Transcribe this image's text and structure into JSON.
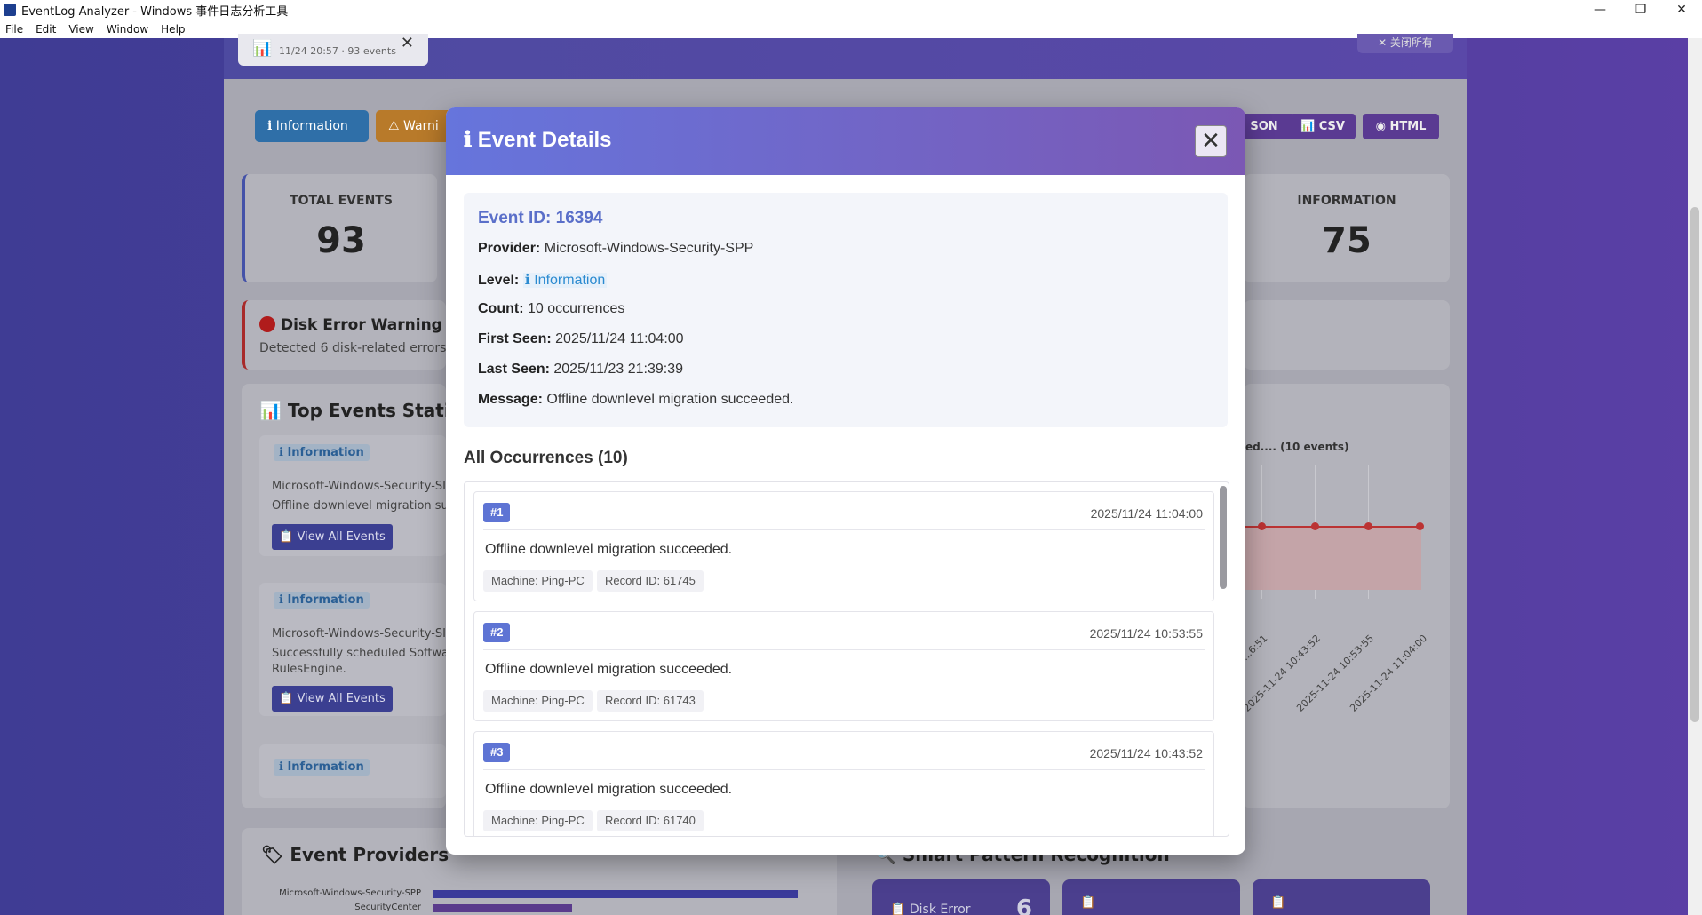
{
  "window": {
    "title": "EventLog Analyzer - Windows 事件日志分析工具",
    "controls": {
      "minimize": "—",
      "restore": "❐",
      "close": "✕"
    }
  },
  "menu": [
    "File",
    "Edit",
    "View",
    "Window",
    "Help"
  ],
  "background": {
    "report_tab": {
      "sub": "11/24 20:57 · 93 events"
    },
    "close_all": "✕ 关闭所有",
    "filters": {
      "information": "ℹ Information",
      "warning": "⚠ Warni"
    },
    "exports": {
      "json": "SON",
      "csv": "CSV",
      "html": "HTML"
    },
    "stats": {
      "total_label": "TOTAL EVENTS",
      "total_value": "93",
      "info_label": "INFORMATION",
      "info_value": "75"
    },
    "disk_warning": {
      "title": "Disk Error Warning",
      "desc": "Detected 6 disk-related errors"
    },
    "top_events": {
      "title": "Top Events Statisti",
      "items": [
        {
          "level": "ℹ Information",
          "line1": "Microsoft-Windows-Security-SI",
          "line2": "Offline downlevel migration succ",
          "button": "View All Events"
        },
        {
          "level": "ℹ Information",
          "line1": "Microsoft-Windows-Security-SI",
          "line2": "Successfully scheduled Software",
          "line3": "RulesEngine.",
          "button": "View All Events"
        },
        {
          "level": "ℹ Information"
        }
      ]
    },
    "chart": {
      "title": "ed.... (10 events)",
      "x_ticks": [
        "...6:51",
        "2025-11-24 10:43:52",
        "2025-11-24 10:53:55",
        "2025-11-24 11:04:00"
      ]
    },
    "providers": {
      "title": "Event Providers",
      "bars": [
        {
          "name": "Microsoft-Windows-Security-SPP",
          "share": 1.0
        },
        {
          "name": "SecurityCenter",
          "share": 0.38
        }
      ]
    },
    "patterns": {
      "title": "Smart Pattern Recognition",
      "cards": [
        {
          "label": "Disk Error",
          "value": "6"
        },
        {
          "label": ""
        },
        {
          "label": ""
        }
      ]
    }
  },
  "modal": {
    "title": "ℹ Event Details",
    "close_icon": "✕",
    "details": {
      "event_id": "Event ID: 16394",
      "provider_label": "Provider:",
      "provider": "Microsoft-Windows-Security-SPP",
      "level_label": "Level:",
      "level": "ℹ Information",
      "count_label": "Count:",
      "count": "10 occurrences",
      "first_seen_label": "First Seen:",
      "first_seen": "2025/11/24 11:04:00",
      "last_seen_label": "Last Seen:",
      "last_seen": "2025/11/23 21:39:39",
      "message_label": "Message:",
      "message": "Offline downlevel migration succeeded."
    },
    "occurrences_title": "All Occurrences (10)",
    "occurrences": [
      {
        "num": "#1",
        "time": "2025/11/24 11:04:00",
        "message": "Offline downlevel migration succeeded.",
        "machine": "Machine: Ping-PC",
        "record": "Record ID: 61745"
      },
      {
        "num": "#2",
        "time": "2025/11/24 10:53:55",
        "message": "Offline downlevel migration succeeded.",
        "machine": "Machine: Ping-PC",
        "record": "Record ID: 61743"
      },
      {
        "num": "#3",
        "time": "2025/11/24 10:43:52",
        "message": "Offline downlevel migration succeeded.",
        "machine": "Machine: Ping-PC",
        "record": "Record ID: 61740"
      }
    ]
  }
}
